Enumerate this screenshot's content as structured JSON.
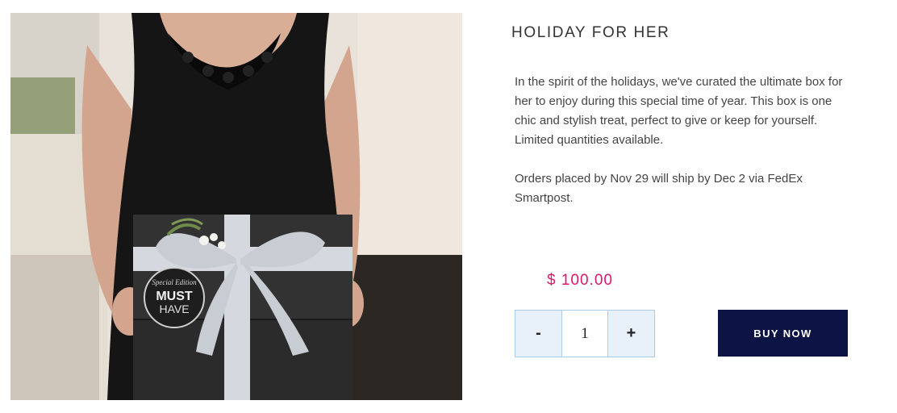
{
  "product": {
    "title": "HOLIDAY FOR HER",
    "description": [
      "In the spirit of the holidays, we've curated the ultimate box for her to enjoy during this special time of year. This box is one chic and stylish treat, perfect to give or keep for yourself.",
      "Limited quantities available.",
      "Orders placed by Nov 29 will ship by Dec 2 via FedEx Smartpost."
    ],
    "price": "$ 100.00",
    "image_box_label": {
      "line1": "Special Edition",
      "line2": "MUST",
      "line3": "HAVE"
    }
  },
  "quantity": {
    "decrement_label": "-",
    "value": "1",
    "increment_label": "+"
  },
  "buy_button_label": "BUY NOW",
  "colors": {
    "price": "#e0166b",
    "buy_button": "#0c1446",
    "quantity_border": "#a9cde6",
    "quantity_button_bg": "#e8f1f9"
  }
}
